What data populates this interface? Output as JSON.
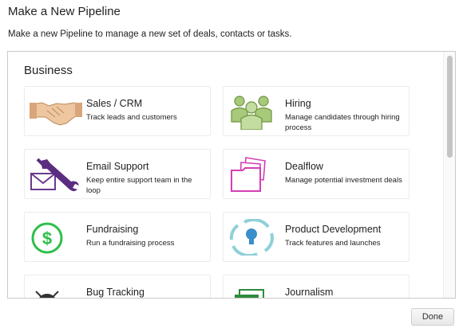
{
  "dialog": {
    "title": "Make a New Pipeline",
    "description": "Make a new Pipeline to manage a new set of deals, contacts or tasks.",
    "done_label": "Done"
  },
  "section": {
    "heading": "Business"
  },
  "templates": [
    {
      "title": "Sales / CRM",
      "description": "Track leads and customers",
      "icon": "handshake-icon"
    },
    {
      "title": "Hiring",
      "description": "Manage candidates through hiring process",
      "icon": "people-icon"
    },
    {
      "title": "Email Support",
      "description": "Keep entire support team in the loop",
      "icon": "envelope-wrench-icon"
    },
    {
      "title": "Dealflow",
      "description": "Manage potential investment deals",
      "icon": "folders-icon"
    },
    {
      "title": "Fundraising",
      "description": "Run a fundraising process",
      "icon": "dollar-icon"
    },
    {
      "title": "Product Development",
      "description": "Track features and launches",
      "icon": "lightbulb-cycle-icon"
    },
    {
      "title": "Bug Tracking",
      "description": "",
      "icon": "bug-icon"
    },
    {
      "title": "Journalism",
      "description": "",
      "icon": "newspaper-icon"
    }
  ],
  "colors": {
    "handshake": "#e8b98a",
    "hiring": "#8cb45c",
    "email_support": "#6a3a8c",
    "dealflow": "#d43fb4",
    "fundraising": "#2ebf4a",
    "product_development": "#6cc0cc",
    "bug": "#333333",
    "journalism": "#2e8b3e"
  }
}
